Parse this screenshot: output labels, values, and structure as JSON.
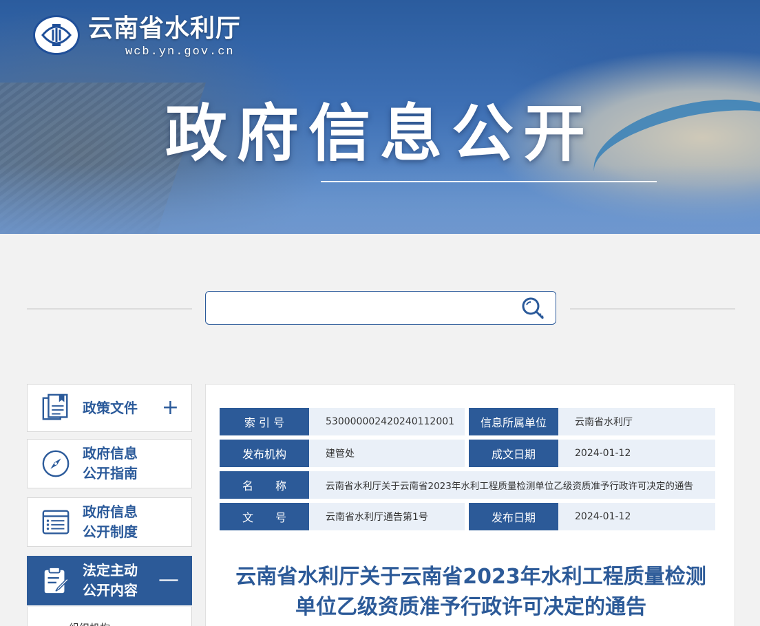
{
  "site": {
    "name": "云南省水利厅",
    "domain": "wcb.yn.gov.cn",
    "banner_title": "政府信息公开",
    "brand_color": "#2c5a98"
  },
  "search": {
    "value": "",
    "placeholder": ""
  },
  "sidebar": {
    "items": [
      {
        "label": "政策文件",
        "icon": "document-icon",
        "toggle": "+"
      },
      {
        "label": "政府信息\n公开指南",
        "icon": "compass-icon"
      },
      {
        "label": "政府信息\n公开制度",
        "icon": "list-icon"
      },
      {
        "label": "法定主动\n公开内容",
        "icon": "clipboard-edit-icon",
        "toggle": "—",
        "active": true
      }
    ],
    "sub_items": [
      "组织机构"
    ]
  },
  "meta": {
    "index_label": "索 引 号",
    "index_value": "530000002420240112001",
    "unit_label": "信息所属单位",
    "unit_value": "云南省水利厅",
    "publisher_label": "发布机构",
    "publisher_value": "建管处",
    "created_label": "成文日期",
    "created_value": "2024-01-12",
    "name_label": "名　　称",
    "name_value": "云南省水利厅关于云南省2023年水利工程质量检测单位乙级资质准予行政许可决定的通告",
    "docno_label": "文　　号",
    "docno_value": "云南省水利厅通告第1号",
    "published_label": "发布日期",
    "published_value": "2024-01-12"
  },
  "document": {
    "title_line1": "云南省水利厅关于云南省2023年水利工程质量检测",
    "title_line2": "单位乙级资质准予行政许可决定的通告"
  }
}
